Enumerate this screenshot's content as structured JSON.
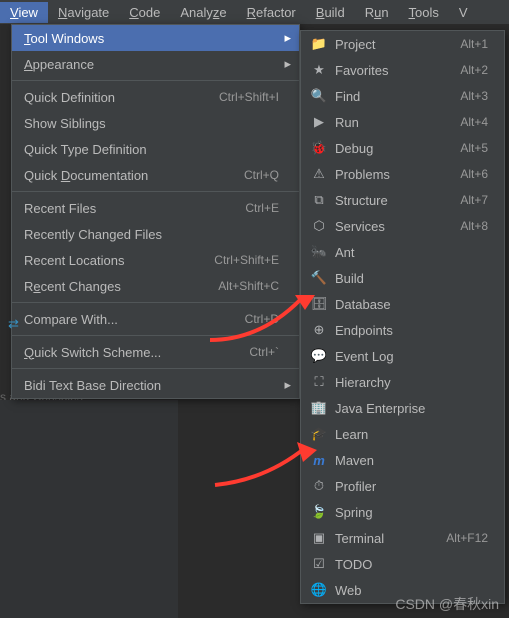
{
  "menubar": {
    "view": "View",
    "navigate": "Navigate",
    "code": "Code",
    "analyze": "Analyze",
    "refactor": "Refactor",
    "build": "Build",
    "run": "Run",
    "tools": "Tools",
    "v": "V"
  },
  "viewMenu": {
    "toolWindows": "Tool Windows",
    "appearance": "Appearance",
    "quickDefinition": "Quick Definition",
    "quickDefinitionSc": "Ctrl+Shift+I",
    "showSiblings": "Show Siblings",
    "quickTypeDef": "Quick Type Definition",
    "quickDoc": "Quick Documentation",
    "quickDocSc": "Ctrl+Q",
    "recentFiles": "Recent Files",
    "recentFilesSc": "Ctrl+E",
    "recentlyChanged": "Recently Changed Files",
    "recentLocations": "Recent Locations",
    "recentLocationsSc": "Ctrl+Shift+E",
    "recentChanges": "Recent Changes",
    "recentChangesSc": "Alt+Shift+C",
    "compareWith": "Compare With...",
    "compareWithSc": "Ctrl+D",
    "quickSwitch": "Quick Switch Scheme...",
    "quickSwitchSc": "Ctrl+`",
    "bidiText": "Bidi Text Base Direction"
  },
  "toolWindows": {
    "project": {
      "label": "Project",
      "sc": "Alt+1"
    },
    "favorites": {
      "label": "Favorites",
      "sc": "Alt+2"
    },
    "find": {
      "label": "Find",
      "sc": "Alt+3"
    },
    "run": {
      "label": "Run",
      "sc": "Alt+4"
    },
    "debug": {
      "label": "Debug",
      "sc": "Alt+5"
    },
    "problems": {
      "label": "Problems",
      "sc": "Alt+6"
    },
    "structure": {
      "label": "Structure",
      "sc": "Alt+7"
    },
    "services": {
      "label": "Services",
      "sc": "Alt+8"
    },
    "ant": {
      "label": "Ant",
      "sc": ""
    },
    "build": {
      "label": "Build",
      "sc": ""
    },
    "database": {
      "label": "Database",
      "sc": ""
    },
    "endpoints": {
      "label": "Endpoints",
      "sc": ""
    },
    "eventlog": {
      "label": "Event Log",
      "sc": ""
    },
    "hierarchy": {
      "label": "Hierarchy",
      "sc": ""
    },
    "javaee": {
      "label": "Java Enterprise",
      "sc": ""
    },
    "learn": {
      "label": "Learn",
      "sc": ""
    },
    "maven": {
      "label": "Maven",
      "sc": ""
    },
    "profiler": {
      "label": "Profiler",
      "sc": ""
    },
    "spring": {
      "label": "Spring",
      "sc": ""
    },
    "terminal": {
      "label": "Terminal",
      "sc": "Alt+F12"
    },
    "todo": {
      "label": "TODO",
      "sc": ""
    },
    "web": {
      "label": "Web",
      "sc": ""
    }
  },
  "bgText": "s and Consoles",
  "watermark": "CSDN @春秋xin"
}
